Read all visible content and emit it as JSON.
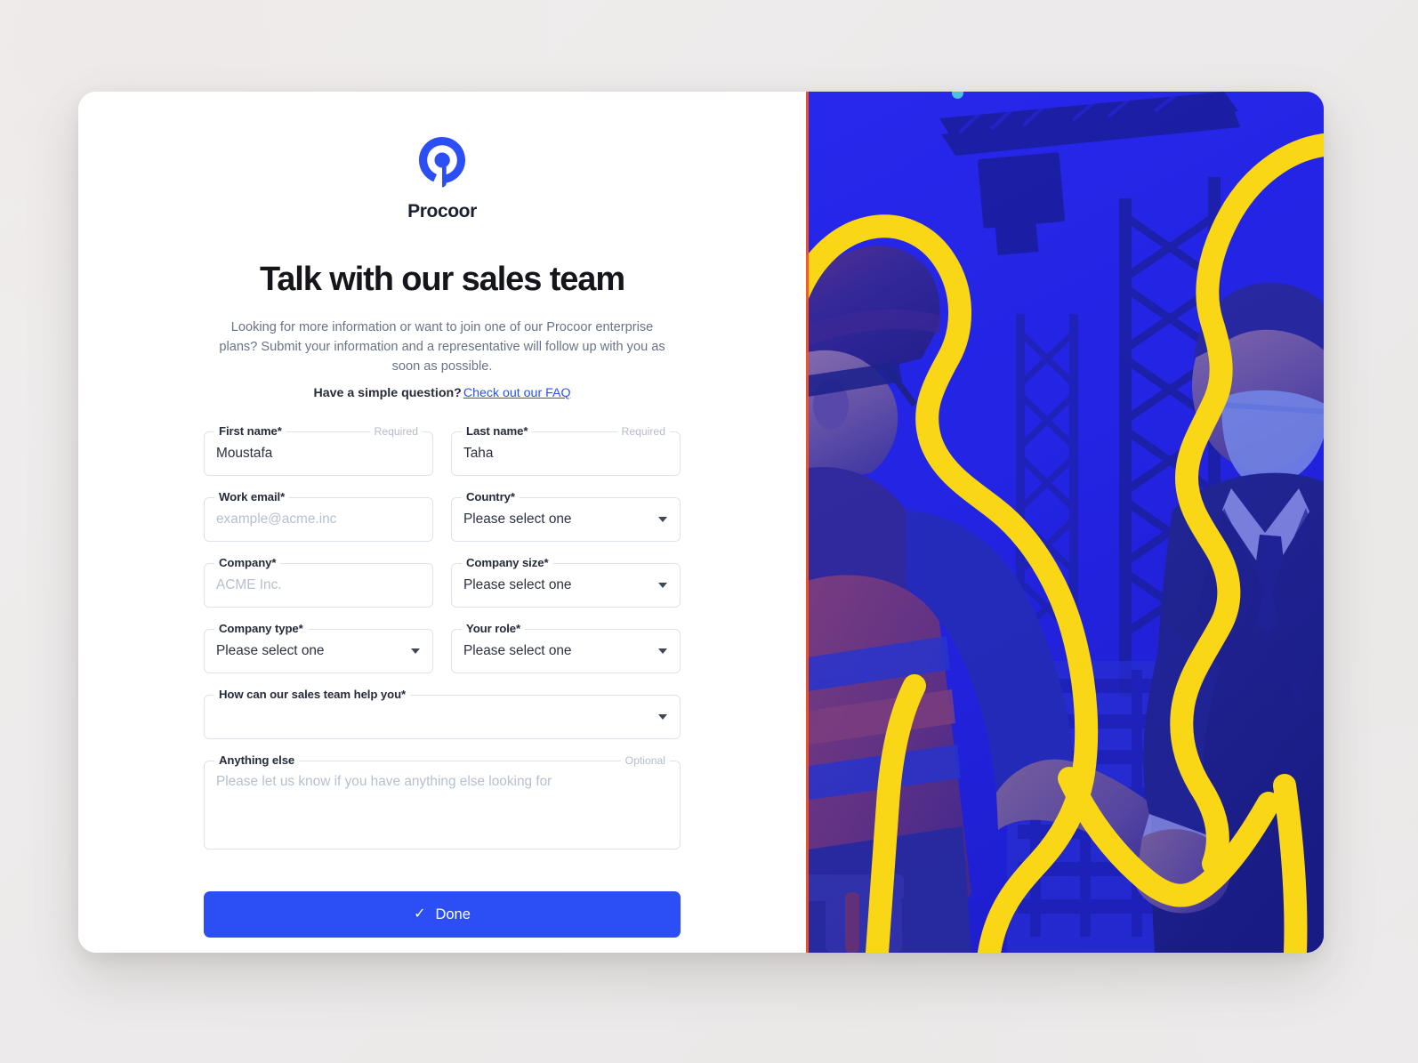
{
  "brand": {
    "name": "Procoor",
    "logo_icon": "procoor-spiral-pin-logo",
    "logo_color": "#2c4ef5"
  },
  "header": {
    "title": "Talk with our sales team",
    "intro": "Looking for more information or want to join one of our Procoor enterprise plans? Submit your information and a representative will follow up with you as soon as possible.",
    "faq_prompt": "Have a simple question?",
    "faq_link_label": "Check out our FAQ",
    "faq_link_color": "#2c4ef5"
  },
  "form": {
    "fields": [
      {
        "name": "first-name",
        "label": "First name*",
        "hint": "Required",
        "value": "Moustafa",
        "placeholder": "",
        "type": "text",
        "width": "half"
      },
      {
        "name": "last-name",
        "label": "Last name*",
        "hint": "Required",
        "value": "Taha",
        "placeholder": "",
        "type": "text",
        "width": "half"
      },
      {
        "name": "work-email",
        "label": "Work email*",
        "hint": "",
        "value": "",
        "placeholder": "example@acme.inc",
        "type": "text",
        "width": "half"
      },
      {
        "name": "country",
        "label": "Country*",
        "hint": "",
        "value": "Please select one",
        "placeholder": "",
        "type": "select",
        "width": "half"
      },
      {
        "name": "company",
        "label": "Company*",
        "hint": "",
        "value": "",
        "placeholder": "ACME Inc.",
        "type": "text",
        "width": "half"
      },
      {
        "name": "company-size",
        "label": "Company size*",
        "hint": "",
        "value": "Please select one",
        "placeholder": "",
        "type": "select",
        "width": "half"
      },
      {
        "name": "company-type",
        "label": "Company type*",
        "hint": "",
        "value": "Please select one",
        "placeholder": "",
        "type": "select",
        "width": "half"
      },
      {
        "name": "your-role",
        "label": "Your role*",
        "hint": "",
        "value": "Please select one",
        "placeholder": "",
        "type": "select",
        "width": "half"
      },
      {
        "name": "sales-help",
        "label": "How can our sales team help you*",
        "hint": "",
        "value": "",
        "placeholder": "",
        "type": "select",
        "width": "full"
      },
      {
        "name": "anything-else",
        "label": "Anything else",
        "hint": "Optional",
        "value": "",
        "placeholder": "Please let us know if you have anything else looking for",
        "type": "textarea",
        "width": "full"
      }
    ],
    "submit": {
      "label": "Done",
      "check_glyph": "✓",
      "color": "#2c4ef5"
    }
  },
  "photo": {
    "alt": "Construction worker in hard hat shaking hands with a businessman on a building site, blue duotone with yellow outline graphic",
    "tint_color": "#2323e0",
    "outline_color": "#f9d616",
    "accent_rule_color": "#f4522a",
    "dot_color": "#4ec0e0"
  }
}
